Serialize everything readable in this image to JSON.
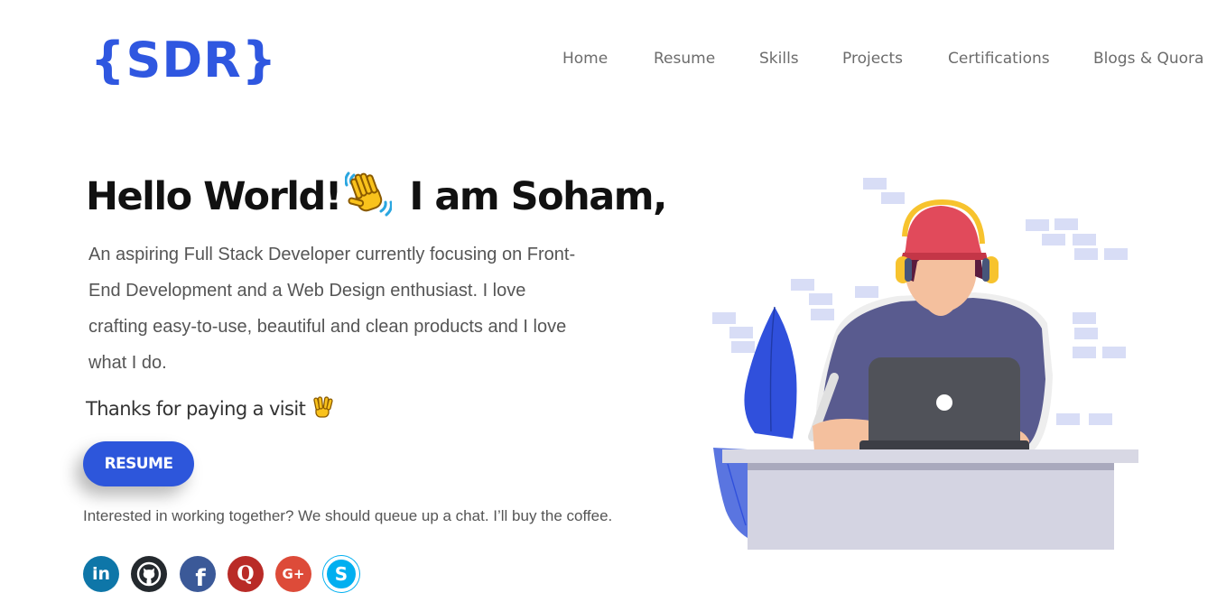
{
  "brand": {
    "logo_text": "{SDR}",
    "color": "#2f57e0"
  },
  "nav": {
    "items": [
      {
        "label": "Home"
      },
      {
        "label": "Resume"
      },
      {
        "label": "Skills"
      },
      {
        "label": "Projects"
      },
      {
        "label": "Certifications"
      },
      {
        "label": "Blogs & Quora"
      }
    ]
  },
  "hero": {
    "title_part1": "Hello World!",
    "title_part2": "I am Soham,",
    "intro": "An aspiring Full Stack Developer currently focusing on Front-End Development and a Web Design enthusiast. I love crafting easy-to-use, beautiful and clean products and I love what I do.",
    "thanks": "Thanks for paying a visit",
    "resume_button": "RESUME",
    "collab": "Interested in working together? We should queue up a chat. I’ll buy the coffee."
  },
  "socials": [
    {
      "name": "linkedin-icon",
      "glyph": "in",
      "color": "#0e76a8"
    },
    {
      "name": "github-icon",
      "glyph": "",
      "color": "#24292e"
    },
    {
      "name": "facebook-icon",
      "glyph": "f",
      "color": "#3b5998"
    },
    {
      "name": "quora-icon",
      "glyph": "Q",
      "color": "#b92b27"
    },
    {
      "name": "google-plus-icon",
      "glyph": "G+",
      "color": "#dd4b39"
    },
    {
      "name": "skype-icon",
      "glyph": "S",
      "color": "#00aff0"
    }
  ],
  "accent": "#2d56db"
}
